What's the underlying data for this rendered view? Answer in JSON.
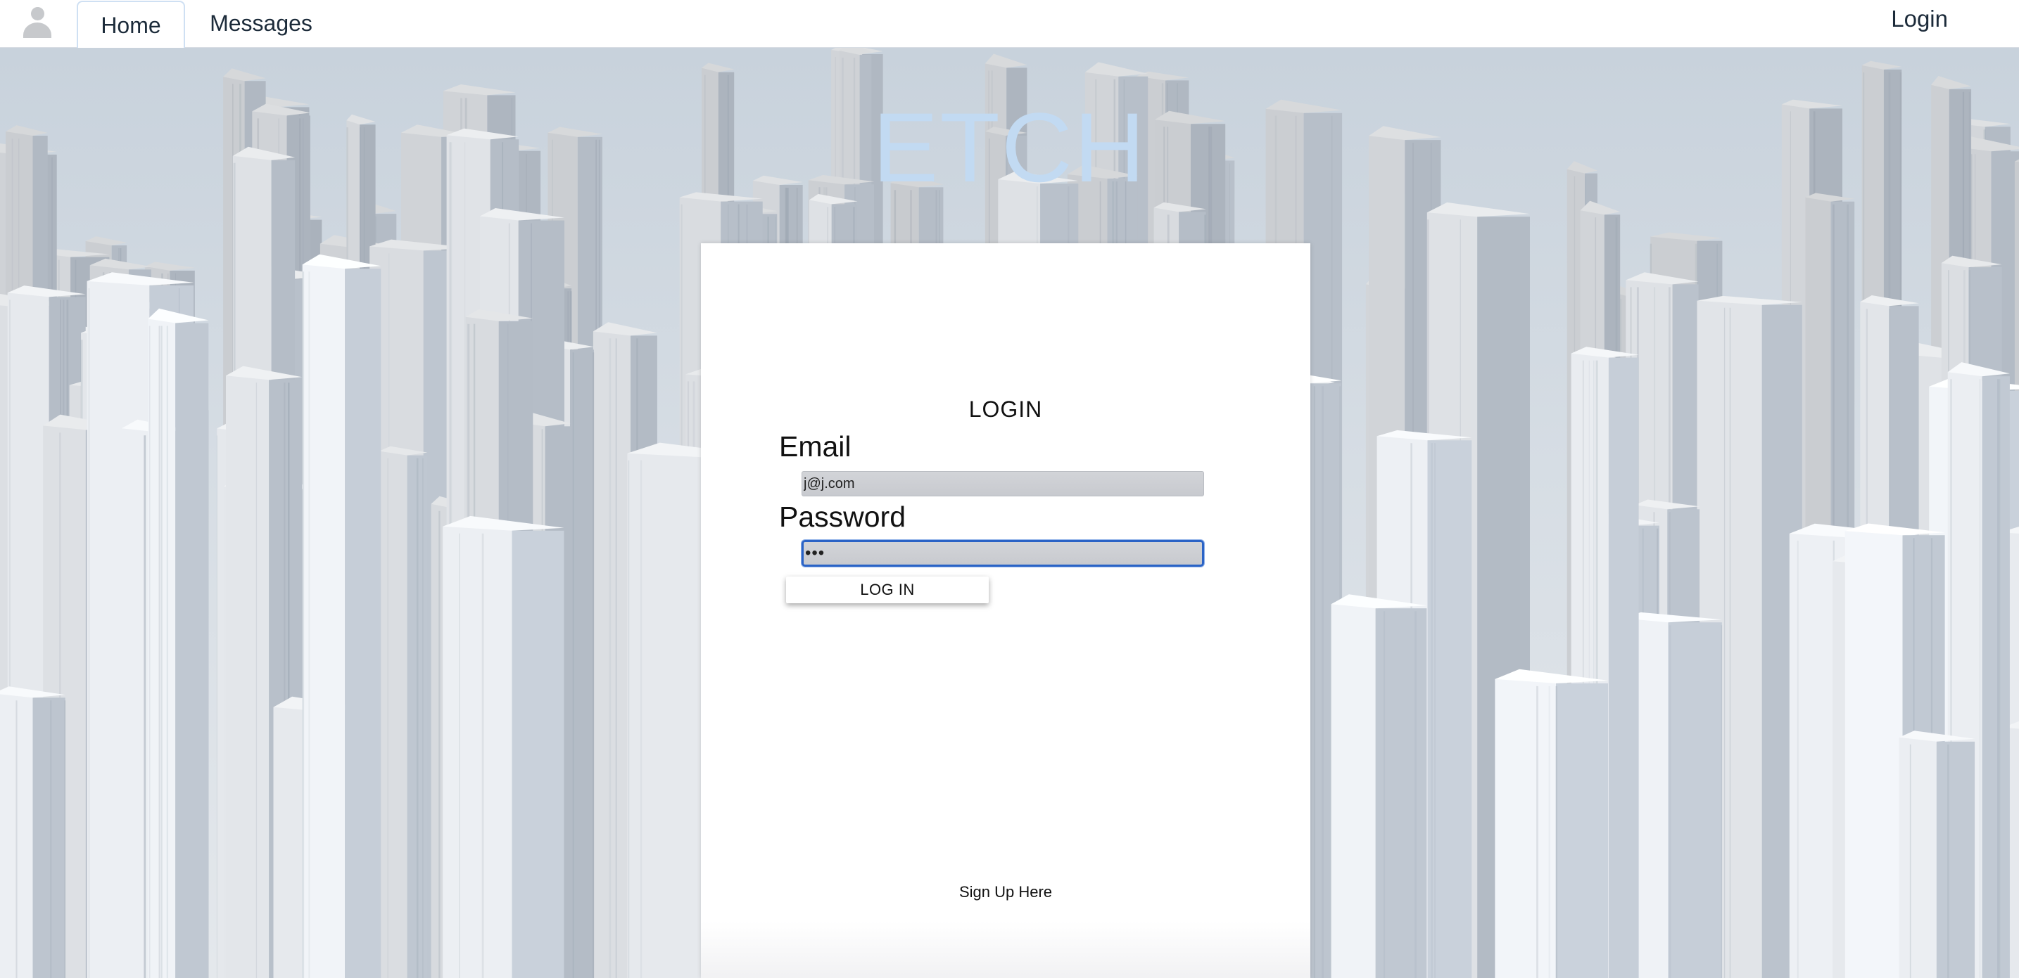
{
  "navbar": {
    "avatar_icon": "user-avatar-icon",
    "tabs": [
      {
        "label": "Home",
        "active": true
      },
      {
        "label": "Messages",
        "active": false
      }
    ],
    "login_link": "Login"
  },
  "hero": {
    "brand": "ETCH",
    "brand_color": "#c2daf2"
  },
  "login_form": {
    "title": "LOGIN",
    "email_label": "Email",
    "email_value": "j@j.com",
    "password_label": "Password",
    "password_value": "•••",
    "submit_label": "LOG IN",
    "signup_link": "Sign Up Here",
    "focus_color": "#2a63c6"
  }
}
